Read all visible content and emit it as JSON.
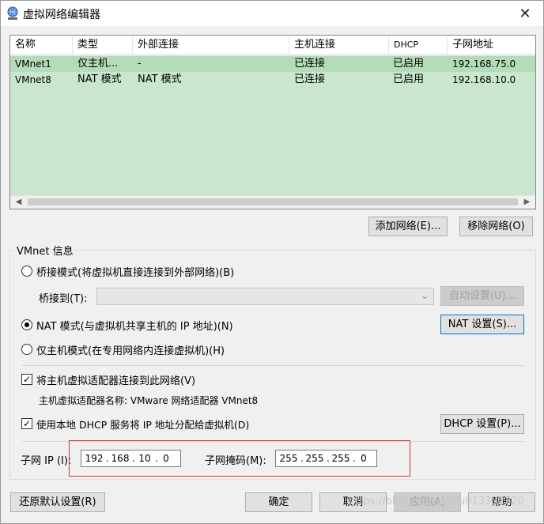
{
  "window": {
    "title": "虚拟网络编辑器"
  },
  "table": {
    "columns": [
      "名称",
      "类型",
      "外部连接",
      "主机连接",
      "DHCP",
      "子网地址"
    ],
    "rows": [
      [
        "VMnet1",
        "仅主机...",
        "-",
        "已连接",
        "已启用",
        "192.168.75.0"
      ],
      [
        "VMnet8",
        "NAT 模式",
        "NAT 模式",
        "已连接",
        "已启用",
        "192.168.10.0"
      ]
    ],
    "selected_row": 0
  },
  "buttons": {
    "add_network": "添加网络(E)...",
    "remove_network": "移除网络(O)",
    "auto_settings": "自动设置(U)...",
    "nat_settings": "NAT 设置(S)...",
    "dhcp_settings": "DHCP 设置(P)...",
    "restore_defaults": "还原默认设置(R)",
    "ok": "确定",
    "cancel": "取消",
    "apply": "应用(A)",
    "help": "帮助"
  },
  "vmnet_info": {
    "group_title": "VMnet 信息",
    "bridge_mode": "桥接模式(将虚拟机直接连接到外部网络)(B)",
    "bridge_to_label": "桥接到(T):",
    "bridge_to_value": "",
    "nat_mode": "NAT 模式(与虚拟机共享主机的 IP 地址)(N)",
    "host_only_mode": "仅主机模式(在专用网络内连接虚拟机)(H)",
    "selected_mode": "nat",
    "connect_host_adapter": "将主机虚拟适配器连接到此网络(V)",
    "connect_host_adapter_checked": true,
    "host_adapter_name": "主机虚拟适配器名称: VMware 网络适配器 VMnet8",
    "use_dhcp": "使用本地 DHCP 服务将 IP 地址分配给虚拟机(D)",
    "use_dhcp_checked": true,
    "subnet_ip_label": "子网 IP (I):",
    "subnet_ip": [
      "192",
      "168",
      "10",
      "0"
    ],
    "subnet_mask_label": "子网掩码(M):",
    "subnet_mask": [
      "255",
      "255",
      "255",
      "0"
    ]
  },
  "watermark": "https://blog.csdn.net/u013332320",
  "colors": {
    "selection": "#b4dcb9",
    "list_bg": "#c9e7cc",
    "highlight_box": "#e53935",
    "focus": "#0078d7"
  }
}
